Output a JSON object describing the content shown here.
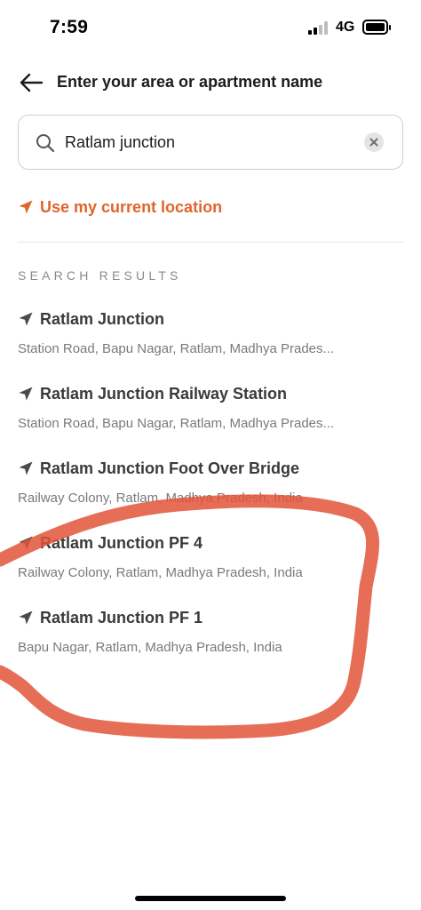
{
  "status_bar": {
    "time": "7:59",
    "network": "4G",
    "icons": [
      "signal-icon",
      "battery-icon"
    ]
  },
  "header": {
    "title": "Enter your area or apartment name",
    "back_icon": "arrow-left-icon"
  },
  "search": {
    "value": "Ratlam junction",
    "icon": "search-icon",
    "clear_icon": "clear-icon"
  },
  "current_location": {
    "label": "Use my current location",
    "icon": "location-arrow-icon",
    "color": "#e0652b"
  },
  "results": {
    "heading": "SEARCH RESULTS",
    "items": [
      {
        "title": "Ratlam Junction",
        "subtitle": "Station Road, Bapu Nagar, Ratlam, Madhya Prades..."
      },
      {
        "title": "Ratlam Junction Railway Station",
        "subtitle": "Station Road, Bapu Nagar, Ratlam, Madhya Prades..."
      },
      {
        "title": "Ratlam Junction Foot Over Bridge",
        "subtitle": "Railway Colony, Ratlam, Madhya Pradesh, India"
      },
      {
        "title": "Ratlam Junction PF 4",
        "subtitle": "Railway Colony, Ratlam, Madhya Pradesh, India"
      },
      {
        "title": "Ratlam Junction PF 1",
        "subtitle": "Bapu Nagar, Ratlam, Madhya Pradesh, India"
      }
    ]
  },
  "annotation": {
    "color": "#e2553a",
    "shape": "hand-drawn-circle"
  }
}
